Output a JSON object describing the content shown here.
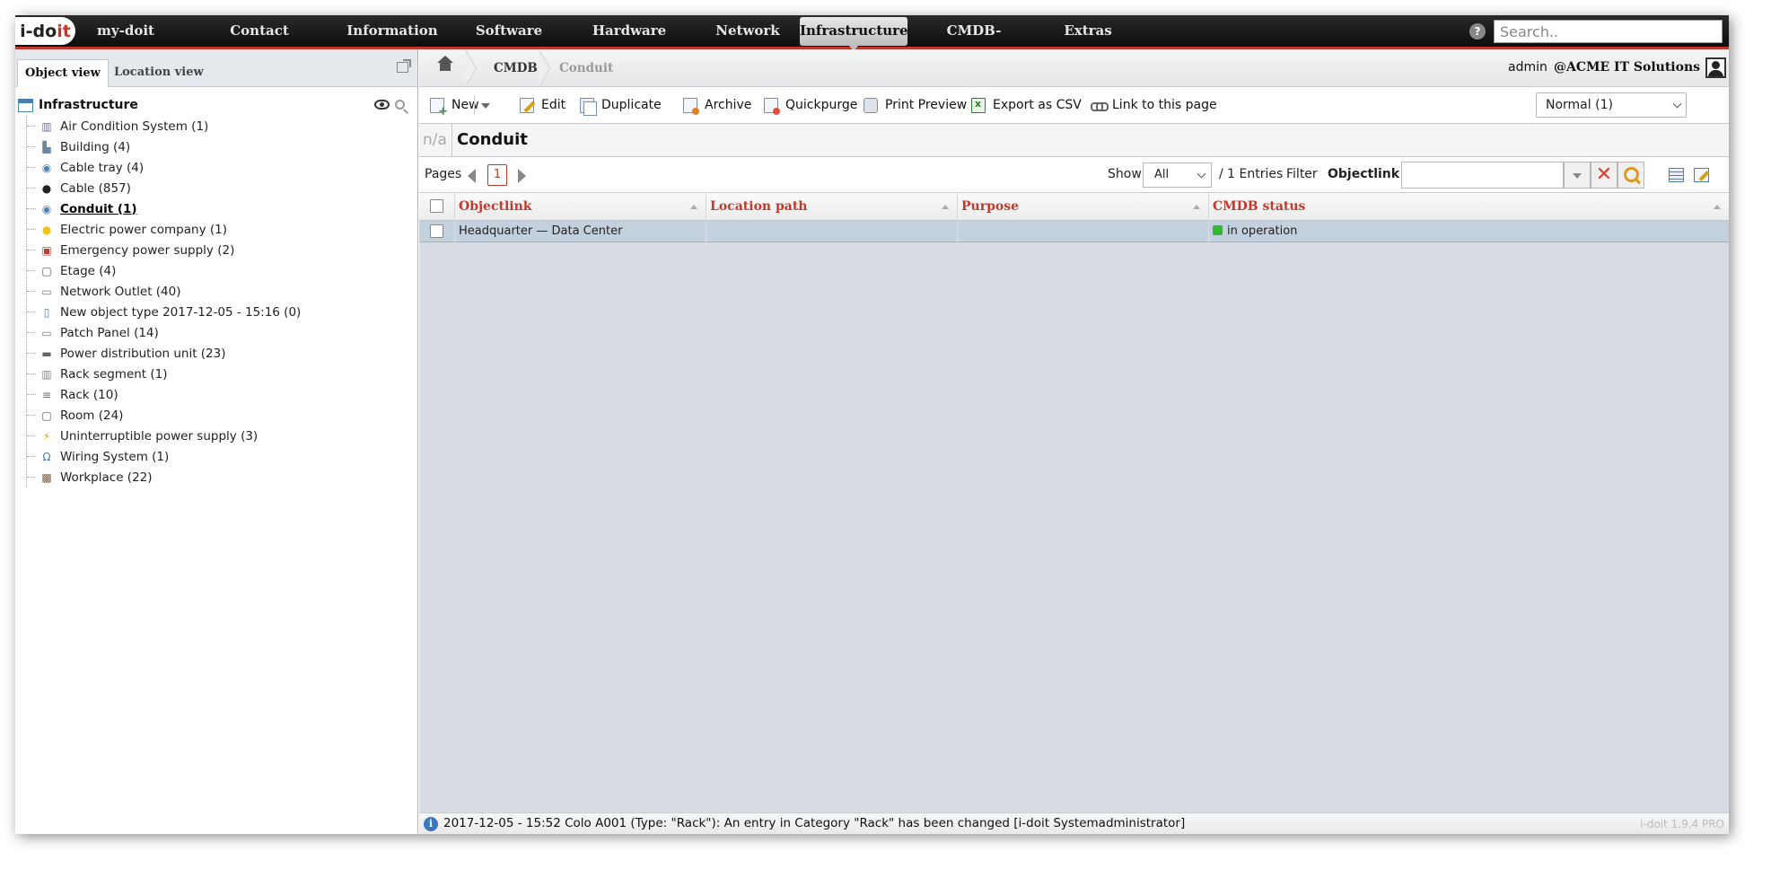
{
  "app": {
    "logo_text_a": "i-do",
    "logo_text_b": "it",
    "search_placeholder": "Search.."
  },
  "nav": {
    "items": [
      "my-doit",
      "Contact",
      "Information",
      "Software",
      "Hardware",
      "Network",
      "Infrastructure",
      "CMDB-Explorer",
      "Extras"
    ],
    "active": "Infrastructure"
  },
  "left_panel": {
    "tabs": [
      "Object view",
      "Location view"
    ],
    "active_tab": "Object view",
    "root_label": "Infrastructure",
    "items": [
      {
        "label": "Air Condition System (1)",
        "icon": "air-condition-icon"
      },
      {
        "label": "Building (4)",
        "icon": "building-icon"
      },
      {
        "label": "Cable tray (4)",
        "icon": "cable-tray-icon"
      },
      {
        "label": "Cable (857)",
        "icon": "cable-icon"
      },
      {
        "label": "Conduit (1)",
        "icon": "conduit-icon",
        "selected": true
      },
      {
        "label": "Electric power company (1)",
        "icon": "lightbulb-icon"
      },
      {
        "label": "Emergency power supply (2)",
        "icon": "generator-icon"
      },
      {
        "label": "Etage (4)",
        "icon": "floor-icon"
      },
      {
        "label": "Network Outlet (40)",
        "icon": "network-outlet-icon"
      },
      {
        "label": "New object type 2017-12-05 - 15:16 (0)",
        "icon": "document-icon"
      },
      {
        "label": "Patch Panel (14)",
        "icon": "patch-panel-icon"
      },
      {
        "label": "Power distribution unit (23)",
        "icon": "power-strip-icon"
      },
      {
        "label": "Rack segment (1)",
        "icon": "rack-segment-icon"
      },
      {
        "label": "Rack (10)",
        "icon": "rack-icon"
      },
      {
        "label": "Room (24)",
        "icon": "room-icon"
      },
      {
        "label": "Uninterruptible power supply (3)",
        "icon": "lightning-icon"
      },
      {
        "label": "Wiring System (1)",
        "icon": "omega-icon"
      },
      {
        "label": "Workplace (22)",
        "icon": "workplace-icon"
      }
    ]
  },
  "breadcrumb": {
    "items": [
      "CMDB",
      "Conduit"
    ]
  },
  "user": {
    "name": "admin",
    "tenant": "@ACME IT Solutions"
  },
  "toolbar": {
    "new_label": "New",
    "edit_label": "Edit",
    "duplicate_label": "Duplicate",
    "archive_label": "Archive",
    "quickpurge_label": "Quickpurge",
    "print_label": "Print Preview",
    "export_label": "Export as CSV",
    "link_label": "Link to this page",
    "status_filter": "Normal (1)"
  },
  "title": {
    "prefix": "n/a",
    "text": "Conduit"
  },
  "pager": {
    "pages_label": "Pages",
    "current_page": "1",
    "show_label": "Show",
    "show_value": "All",
    "entries_label": "/ 1 Entries",
    "filter_label": "Filter",
    "filter_field": "Objectlink",
    "filter_value": ""
  },
  "table": {
    "columns": [
      "Objectlink",
      "Location path",
      "Purpose",
      "CMDB status"
    ],
    "rows": [
      {
        "objectlink": "Headquarter — Data Center",
        "location_path": "",
        "purpose": "",
        "cmdb_status": "in operation",
        "status_color": "#33b833"
      }
    ]
  },
  "statusbar": {
    "message": "2017-12-05 - 15:52 Colo A001 (Type: \"Rack\"): An entry in Category \"Rack\" has been changed [i-doit Systemadministrator]",
    "version": "i-doit 1.9.4 PRO"
  },
  "colors": {
    "accent": "#c0392b",
    "selected_row": "#c3d0de",
    "main_bg": "#d7dde3"
  }
}
